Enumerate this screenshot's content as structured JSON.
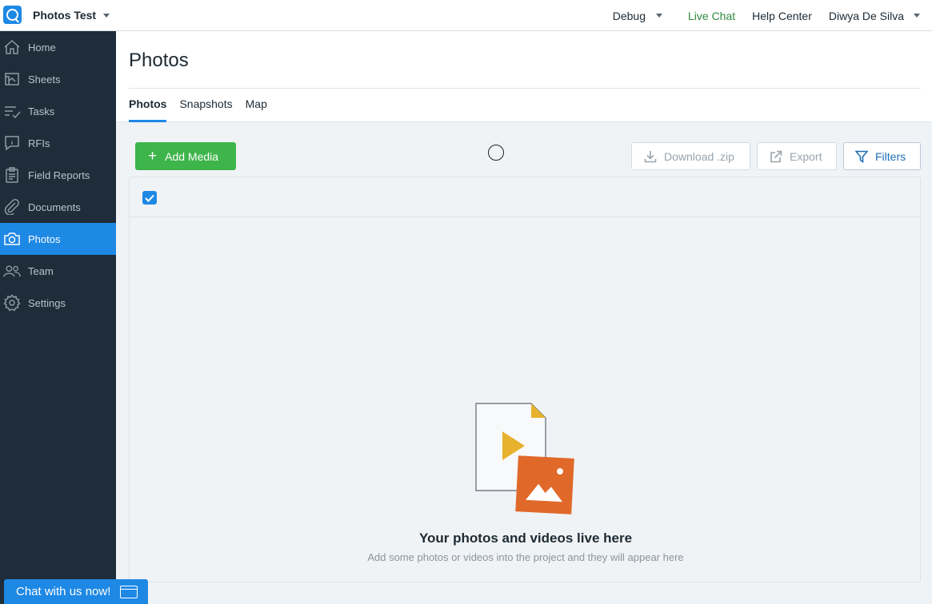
{
  "topbar": {
    "project_name": "Photos Test",
    "debug_label": "Debug",
    "live_chat_label": "Live Chat",
    "help_center_label": "Help Center",
    "user_name": "Diwya De Silva"
  },
  "sidebar": {
    "items": [
      {
        "label": "Home",
        "icon": "home-icon"
      },
      {
        "label": "Sheets",
        "icon": "sheets-icon"
      },
      {
        "label": "Tasks",
        "icon": "tasks-icon"
      },
      {
        "label": "RFIs",
        "icon": "rfi-icon"
      },
      {
        "label": "Field Reports",
        "icon": "clipboard-icon"
      },
      {
        "label": "Documents",
        "icon": "paperclip-icon"
      },
      {
        "label": "Photos",
        "icon": "camera-icon",
        "active": true
      },
      {
        "label": "Team",
        "icon": "team-icon"
      },
      {
        "label": "Settings",
        "icon": "gear-icon"
      }
    ]
  },
  "main": {
    "title": "Photos",
    "tabs": [
      "Photos",
      "Snapshots",
      "Map"
    ],
    "active_tab": "Photos",
    "toolbar": {
      "add_media_label": "Add Media",
      "download_label": "Download .zip",
      "export_label": "Export",
      "filters_label": "Filters"
    },
    "empty_state": {
      "title": "Your photos and videos live here",
      "subtitle": "Add some photos or videos into the project and they will appear here"
    }
  },
  "chat_widget": {
    "label": "Chat with us now!"
  },
  "colors": {
    "accent": "#1e88e5",
    "sidebar_bg": "#1f2d3a",
    "add_button": "#3db54a",
    "live_chat": "#2e8b3d",
    "illustration_yellow": "#e8b22f",
    "illustration_orange": "#e0692a"
  }
}
